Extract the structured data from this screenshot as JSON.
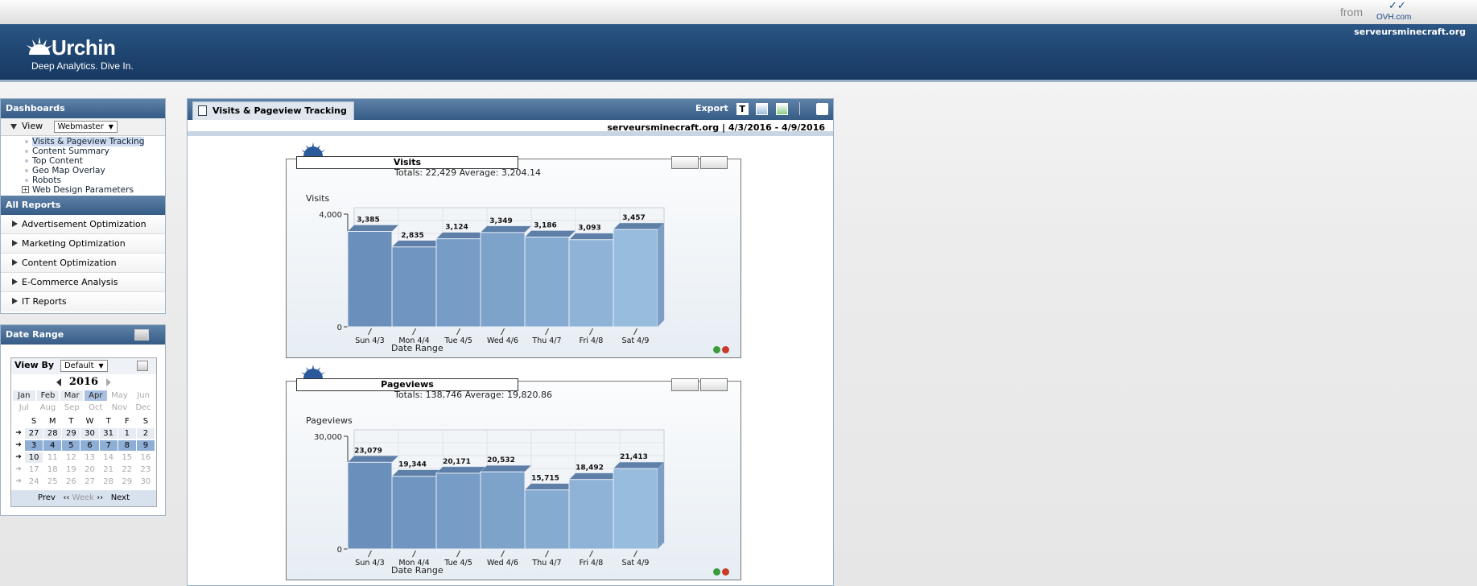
{
  "top": {
    "from_label": "from",
    "ovh_word": "OVH.com"
  },
  "header": {
    "brand_name": "Urchin",
    "brand_tagline": "Deep Analytics. Dive In.",
    "site": "serveursminecraft.org"
  },
  "sidebar": {
    "dashboards_title": "Dashboards",
    "view_label": "View",
    "view_select": "Webmaster",
    "dashboard_items": [
      {
        "label": "Visits & Pageview Tracking",
        "active": true
      },
      {
        "label": "Content Summary"
      },
      {
        "label": "Top Content"
      },
      {
        "label": "Geo Map Overlay"
      },
      {
        "label": "Robots"
      },
      {
        "label": "Web Design Parameters",
        "expandable": true
      }
    ],
    "all_reports_title": "All Reports",
    "reports": [
      "Advertisement Optimization",
      "Marketing Optimization",
      "Content Optimization",
      "E-Commerce Analysis",
      "IT Reports"
    ]
  },
  "date_range": {
    "title": "Date Range",
    "view_by_label": "View By",
    "view_by_value": "Default",
    "year": "2016",
    "months": [
      {
        "m": "Jan",
        "s": "avail"
      },
      {
        "m": "Feb",
        "s": "avail"
      },
      {
        "m": "Mar",
        "s": "avail"
      },
      {
        "m": "Apr",
        "s": "sel"
      },
      {
        "m": "May",
        "s": "dis"
      },
      {
        "m": "Jun",
        "s": "dis"
      },
      {
        "m": "Jul",
        "s": "dis"
      },
      {
        "m": "Aug",
        "s": "dis"
      },
      {
        "m": "Sep",
        "s": "dis"
      },
      {
        "m": "Oct",
        "s": "dis"
      },
      {
        "m": "Nov",
        "s": "dis"
      },
      {
        "m": "Dec",
        "s": "dis"
      }
    ],
    "weekdays": [
      "S",
      "M",
      "T",
      "W",
      "T",
      "F",
      "S"
    ],
    "weeks": [
      {
        "days": [
          "27",
          "28",
          "29",
          "30",
          "31",
          "1",
          "2"
        ],
        "style": "w"
      },
      {
        "days": [
          "3",
          "4",
          "5",
          "6",
          "7",
          "8",
          "9"
        ],
        "style": "wsel"
      },
      {
        "days": [
          "10",
          "11",
          "12",
          "13",
          "14",
          "15",
          "16"
        ],
        "style": "part"
      },
      {
        "days": [
          "17",
          "18",
          "19",
          "20",
          "21",
          "22",
          "23"
        ],
        "style": "dis"
      },
      {
        "days": [
          "24",
          "25",
          "26",
          "27",
          "28",
          "29",
          "30"
        ],
        "style": "dis"
      }
    ],
    "nav": {
      "prev": "Prev",
      "week": "Week",
      "next": "Next"
    }
  },
  "main": {
    "tab_title": "Visits & Pageview Tracking",
    "export_label": "Export",
    "export_t": "T",
    "site_range": "serveursminecraft.org  |  4/3/2016 - 4/9/2016"
  },
  "charts": [
    {
      "title": "Visits",
      "totals_text": "Totals: 22,429   Average: 3,204.14",
      "ylabel": "Visits",
      "xlabel": "Date Range",
      "ymax": 4000,
      "ytick_labels": [
        "4,000",
        "0"
      ]
    },
    {
      "title": "Pageviews",
      "totals_text": "Totals: 138,746   Average: 19,820.86",
      "ylabel": "Pageviews",
      "xlabel": "Date Range",
      "ymax": 30000,
      "ytick_labels": [
        "30,000",
        "0"
      ]
    }
  ],
  "chart_data": [
    {
      "type": "bar",
      "title": "Visits",
      "categories": [
        "Sun 4/3",
        "Mon 4/4",
        "Tue 4/5",
        "Wed 4/6",
        "Thu 4/7",
        "Fri 4/8",
        "Sat 4/9"
      ],
      "values": [
        3385,
        2835,
        3124,
        3349,
        3186,
        3093,
        3457
      ],
      "value_labels": [
        "3,385",
        "2,835",
        "3,124",
        "3,349",
        "3,186",
        "3,093",
        "3,457"
      ],
      "xlabel": "Date Range",
      "ylabel": "Visits",
      "ylim": [
        0,
        4000
      ]
    },
    {
      "type": "bar",
      "title": "Pageviews",
      "categories": [
        "Sun 4/3",
        "Mon 4/4",
        "Tue 4/5",
        "Wed 4/6",
        "Thu 4/7",
        "Fri 4/8",
        "Sat 4/9"
      ],
      "values": [
        23079,
        19344,
        20171,
        20532,
        15715,
        18492,
        21413
      ],
      "value_labels": [
        "23,079",
        "19,344",
        "20,171",
        "20,532",
        "15,715",
        "18,492",
        "21,413"
      ],
      "xlabel": "Date Range",
      "ylabel": "Pageviews",
      "ylim": [
        0,
        30000
      ]
    }
  ],
  "colors": {
    "header": "#1e4470",
    "bar_dark": "#6a8fb9",
    "bar_light": "#a3c1e1",
    "dot_green": "#3a9b3a",
    "dot_red": "#c83a2a"
  }
}
